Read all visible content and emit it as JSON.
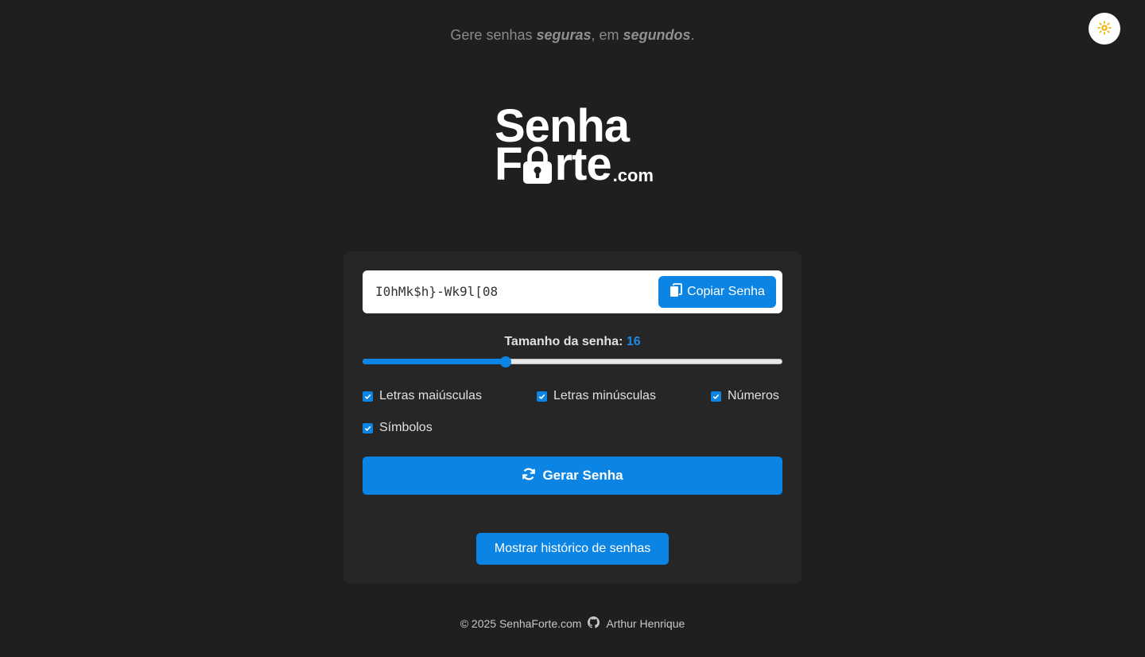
{
  "tagline": {
    "prefix": "Gere senhas ",
    "emphasis1": "seguras",
    "middle": ", em ",
    "emphasis2": "segundos",
    "suffix": "."
  },
  "theme_toggle": {
    "icon": "sun-icon",
    "color": "#f0b400"
  },
  "logo": {
    "line1": "Senha",
    "line2_start": "F",
    "line2_end": "rte",
    "suffix": ".com",
    "lock_icon": "padlock-icon"
  },
  "generator": {
    "password": "I0hMk$h}-Wk9l[08",
    "copy_label": "Copiar Senha",
    "copy_icon": "copy-icon",
    "length_label": "Tamanho da senha:",
    "length_value": "16",
    "length_fraction": 0.34,
    "options": {
      "uppercase": {
        "label": "Letras maiúsculas",
        "checked": true
      },
      "lowercase": {
        "label": "Letras minúsculas",
        "checked": true
      },
      "numbers": {
        "label": "Números",
        "checked": true
      },
      "symbols": {
        "label": "Símbolos",
        "checked": true
      }
    },
    "generate_label": "Gerar Senha",
    "generate_icon": "refresh-icon",
    "history_label": "Mostrar histórico de senhas"
  },
  "footer": {
    "copyright": "© 2025 SenhaForte.com",
    "github_icon": "github-icon",
    "author": "Arthur Henrique"
  },
  "colors": {
    "background": "#1f1f1f",
    "card": "#262626",
    "accent": "#0c84e4",
    "length_value": "#1e88e5"
  }
}
